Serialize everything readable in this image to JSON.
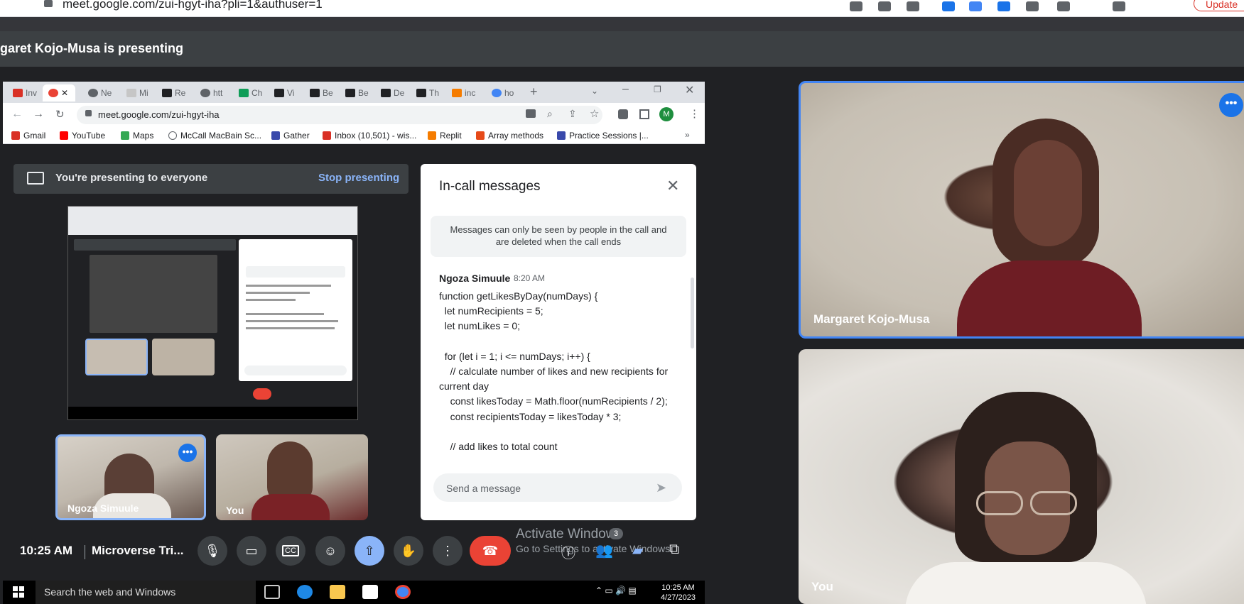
{
  "outer": {
    "url": "meet.google.com/zui-hgyt-iha?pli=1&authuser=1",
    "update_label": "Update"
  },
  "presenter_title": "garet Kojo-Musa is presenting",
  "browser": {
    "tabs": [
      "Inv",
      "",
      "Ne",
      "Mi",
      "Re",
      "htt",
      "Ch",
      "Vi",
      "Be",
      "Be",
      "De",
      "Th",
      "inc",
      "ho"
    ],
    "url": "meet.google.com/zui-hgyt-iha",
    "bookmarks": [
      "Gmail",
      "YouTube",
      "Maps",
      "McCall MacBain Sc...",
      "Gather",
      "Inbox (10,501) - wis...",
      "Replit",
      "Array methods",
      "Practice Sessions |..."
    ]
  },
  "banner": {
    "text": "You're presenting to everyone",
    "stop_label": "Stop presenting"
  },
  "tiles": {
    "ngoza_small": "Ngoza Simuule",
    "you_small": "You",
    "margaret": "Margaret Kojo-Musa",
    "you_big": "You"
  },
  "chat": {
    "title": "In-call messages",
    "notice": "Messages can only be seen by people in the call and are deleted when the call ends",
    "sender": "Ngoza Simuule",
    "time": "8:20 AM",
    "body": "function getLikesByDay(numDays) {\n  let numRecipients = 5;\n  let numLikes = 0;\n\n  for (let i = 1; i <= numDays; i++) {\n    // calculate number of likes and new recipients for current day\n    const likesToday = Math.floor(numRecipients / 2);\n    const recipientsToday = likesToday * 3;\n\n    // add likes to total count",
    "input_placeholder": "Send a message"
  },
  "controls": {
    "clock": "10:25 AM",
    "meeting_name": "Microverse Tri...",
    "people_count": "3"
  },
  "watermark": {
    "title": "Activate Windows",
    "subtitle": "Go to Settings to activate Windows."
  },
  "taskbar": {
    "search": "Search the web and Windows",
    "time": "10:25 AM",
    "date": "4/27/2023"
  },
  "colors": {
    "accent_blue": "#8ab4f8",
    "leave_red": "#ea4335",
    "meet_bg": "#202124"
  }
}
